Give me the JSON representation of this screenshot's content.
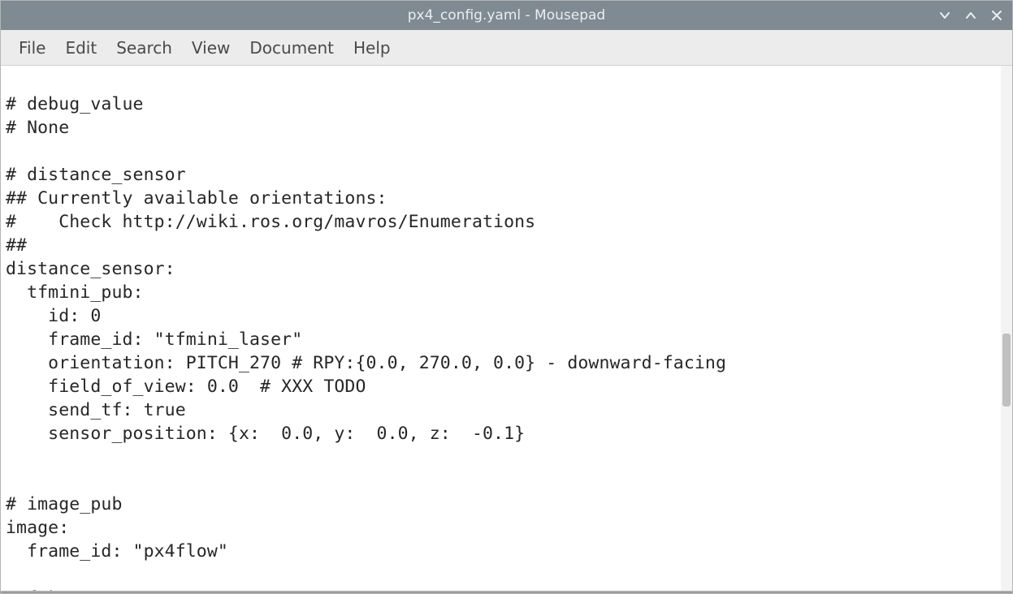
{
  "window": {
    "title": "px4_config.yaml - Mousepad"
  },
  "menu": {
    "file": "File",
    "edit": "Edit",
    "search": "Search",
    "view": "View",
    "document": "Document",
    "help": "Help"
  },
  "editor": {
    "content": "\n# debug_value\n# None\n\n# distance_sensor\n## Currently available orientations:\n#    Check http://wiki.ros.org/mavros/Enumerations\n##\ndistance_sensor:\n  tfmini_pub:\n    id: 0\n    frame_id: \"tfmini_laser\"\n    orientation: PITCH_270 # RPY:{0.0, 270.0, 0.0} - downward-facing\n    field_of_view: 0.0  # XXX TODO\n    send_tf: true\n    sensor_position: {x:  0.0, y:  0.0, z:  -0.1}\n\n\n# image_pub\nimage:\n  frame_id: \"px4flow\"\n\n# fake_gps"
  }
}
